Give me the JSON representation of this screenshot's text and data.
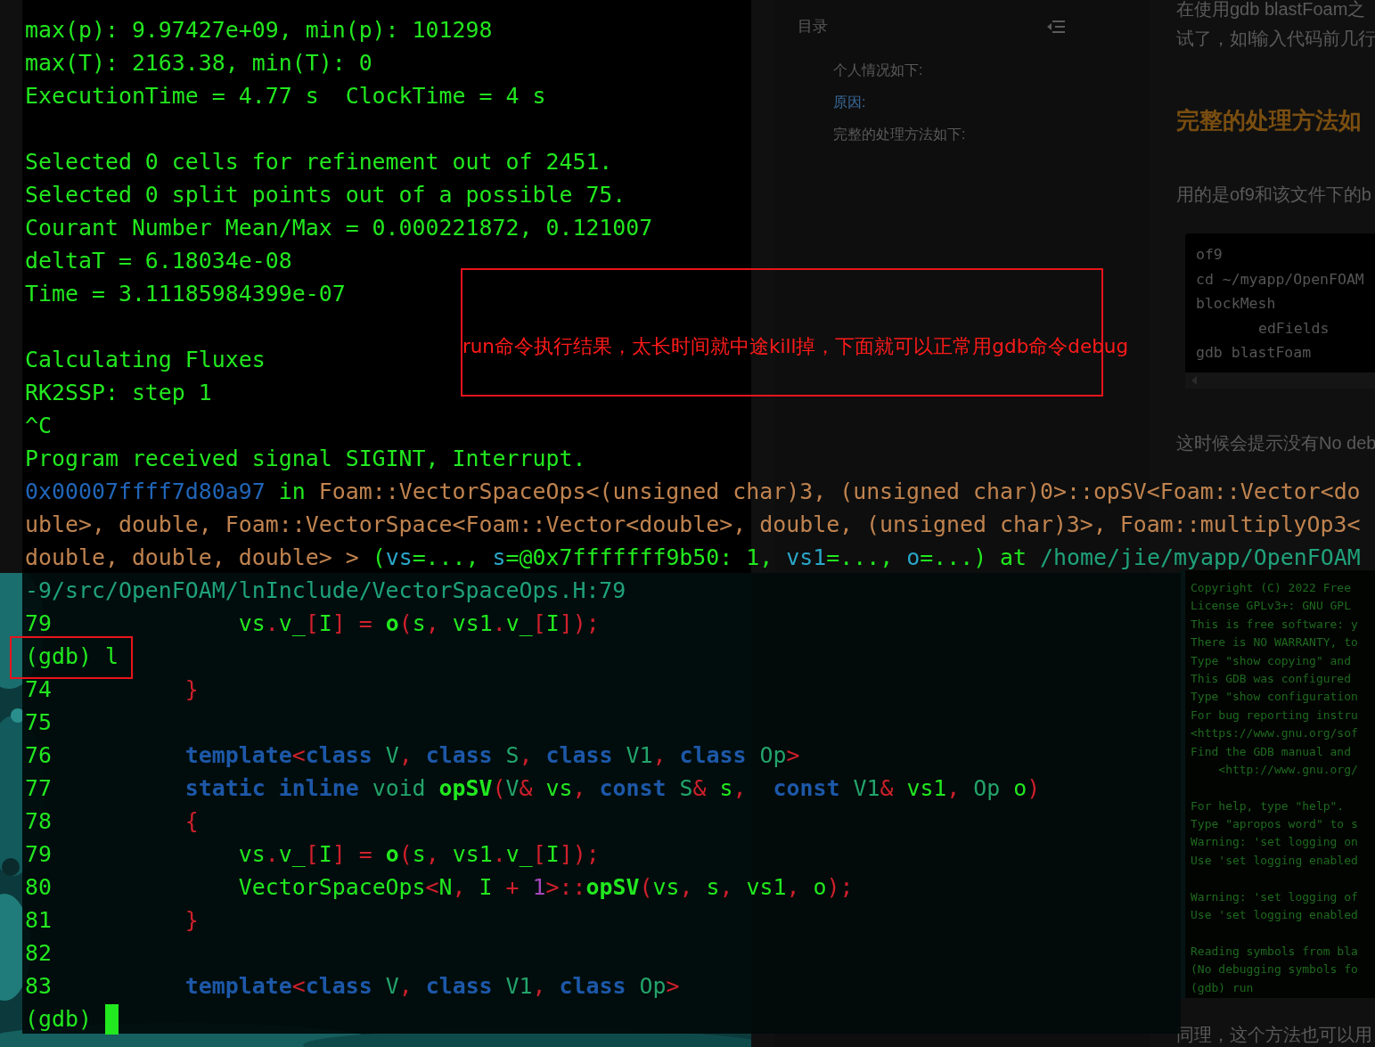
{
  "background_page": {
    "toc": {
      "title": "目录",
      "items": [
        "个人情况如下:",
        "原因:",
        "完整的处理方法如下:"
      ]
    },
    "article": {
      "intro": [
        "在使用gdb blastFoam之",
        "试了，如l输入代码前几行"
      ],
      "heading": "完整的处理方法如",
      "paragraph": "用的是of9和该文件下的b",
      "code_block": [
        {
          "text": "of9"
        },
        {
          "text": "cd ~/myapp/OpenFOAM"
        },
        {
          "text": "blockMesh"
        },
        {
          "text": "edFields"
        },
        {
          "text": "gdb blastFoam"
        }
      ],
      "paragraph_2": "这时候会提示没有No deb",
      "screenshot_lines": [
        {
          "kind": "text",
          "text": "Copyright (C) 2022 Free"
        },
        {
          "kind": "text",
          "text": "License GPLv3+: GNU GPL"
        },
        {
          "kind": "text",
          "text": "This is free software: y"
        },
        {
          "kind": "text",
          "text": "There is NO WARRANTY, to"
        },
        {
          "kind": "text",
          "text": "Type \"show copying\" and"
        },
        {
          "kind": "text",
          "text": "This GDB was configured"
        },
        {
          "kind": "text",
          "text": "Type \"show configuration"
        },
        {
          "kind": "text",
          "text": "For bug reporting instru"
        },
        {
          "kind": "text",
          "text": "<https://www.gnu.org/sof"
        },
        {
          "kind": "text",
          "text": "Find the GDB manual and"
        },
        {
          "kind": "text",
          "text": "    <http://www.gnu.org/"
        },
        {
          "kind": "blank"
        },
        {
          "kind": "text",
          "text": "For help, type \"help\"."
        },
        {
          "kind": "text",
          "text": "Type \"apropos word\" to s"
        },
        {
          "kind": "text",
          "text": "Warning: 'set logging on"
        },
        {
          "kind": "text",
          "text": "Use 'set logging enabled"
        },
        {
          "kind": "blank"
        },
        {
          "kind": "text",
          "text": "Warning: 'set logging of"
        },
        {
          "kind": "text",
          "text": "Use 'set logging enabled"
        },
        {
          "kind": "blank"
        },
        {
          "kind": "text",
          "text": "Reading symbols from bla"
        },
        {
          "kind": "text",
          "text": "(No debugging symbols fo"
        },
        {
          "kind": "text",
          "text": "(gdb) run"
        }
      ],
      "bottom_text": "同理，这个方法也可以用"
    }
  },
  "terminal": {
    "lines": [
      {
        "kind": "text",
        "segments": [
          {
            "t": "max(p): 9.97427e+09, min(p): 101298",
            "kind": "plain"
          }
        ]
      },
      {
        "kind": "text",
        "segments": [
          {
            "t": "max(T): 2163.38, min(T): 0",
            "kind": "plain"
          }
        ]
      },
      {
        "kind": "text",
        "segments": [
          {
            "t": "ExecutionTime = 4.77 s  ClockTime = 4 s",
            "kind": "plain"
          }
        ]
      },
      {
        "kind": "blank"
      },
      {
        "kind": "text",
        "segments": [
          {
            "t": "Selected 0 cells for refinement out of 2451.",
            "kind": "plain"
          }
        ]
      },
      {
        "kind": "text",
        "segments": [
          {
            "t": "Selected 0 split points out of a possible 75.",
            "kind": "plain"
          }
        ]
      },
      {
        "kind": "text",
        "segments": [
          {
            "t": "Courant Number Mean/Max = 0.000221872, 0.121007",
            "kind": "plain"
          }
        ]
      },
      {
        "kind": "text",
        "segments": [
          {
            "t": "deltaT = 6.18034e-08",
            "kind": "plain"
          }
        ]
      },
      {
        "kind": "text",
        "segments": [
          {
            "t": "Time = 3.11185984399e-07",
            "kind": "plain"
          }
        ]
      },
      {
        "kind": "blank"
      },
      {
        "kind": "text",
        "segments": [
          {
            "t": "Calculating Fluxes",
            "kind": "plain"
          }
        ]
      },
      {
        "kind": "text",
        "segments": [
          {
            "t": "RK2SSP: step 1",
            "kind": "plain"
          }
        ]
      },
      {
        "kind": "text",
        "segments": [
          {
            "t": "^C",
            "kind": "plain"
          }
        ]
      },
      {
        "kind": "text",
        "segments": [
          {
            "t": "Program received signal SIGINT, Interrupt.",
            "kind": "plain"
          }
        ]
      },
      {
        "kind": "text",
        "segments": [
          {
            "t": "0x00007ffff7d80a97",
            "kind": "addr"
          },
          {
            "t": " in ",
            "kind": "plain"
          },
          {
            "t": "Foam::VectorSpaceOps<(unsigned char)3, (unsigned char)0>::opSV<Foam::Vector<do",
            "kind": "func"
          }
        ]
      },
      {
        "kind": "text",
        "segments": [
          {
            "t": "uble>, double, Foam::VectorSpace<Foam::Vector<double>, double, (unsigned char)3>, Foam::multiplyOp3<",
            "kind": "func"
          }
        ]
      },
      {
        "kind": "text",
        "segments": [
          {
            "t": "double, double, double> > ",
            "kind": "func"
          },
          {
            "t": "(",
            "kind": "plain"
          },
          {
            "t": "vs",
            "kind": "param"
          },
          {
            "t": "=..., ",
            "kind": "plain"
          },
          {
            "t": "s",
            "kind": "param"
          },
          {
            "t": "=@0x7fffffff9b50: 1, ",
            "kind": "plain"
          },
          {
            "t": "vs1",
            "kind": "param"
          },
          {
            "t": "=..., ",
            "kind": "plain"
          },
          {
            "t": "o",
            "kind": "param"
          },
          {
            "t": "=...) at ",
            "kind": "plain"
          },
          {
            "t": "/home/jie/myapp/OpenFOAM",
            "kind": "path"
          }
        ]
      },
      {
        "kind": "text",
        "segments": [
          {
            "t": "-9/src/OpenFOAM/lnInclude/VectorSpaceOps.H:79",
            "kind": "path"
          }
        ]
      },
      {
        "kind": "text",
        "segments": [
          {
            "t": "79",
            "kind": "plain"
          },
          {
            "t": "              vs",
            "kind": "plain"
          },
          {
            "t": ".",
            "kind": "punct"
          },
          {
            "t": "v_",
            "kind": "plain"
          },
          {
            "t": "[",
            "kind": "punct"
          },
          {
            "t": "I",
            "kind": "plain"
          },
          {
            "t": "] = ",
            "kind": "punct"
          },
          {
            "t": "o",
            "kind": "bold"
          },
          {
            "t": "(",
            "kind": "punct"
          },
          {
            "t": "s",
            "kind": "plain"
          },
          {
            "t": ",",
            "kind": "punct"
          },
          {
            "t": " vs1",
            "kind": "plain"
          },
          {
            "t": ".",
            "kind": "punct"
          },
          {
            "t": "v_",
            "kind": "plain"
          },
          {
            "t": "[",
            "kind": "punct"
          },
          {
            "t": "I",
            "kind": "plain"
          },
          {
            "t": "]);",
            "kind": "punct"
          }
        ]
      },
      {
        "kind": "text",
        "segments": [
          {
            "t": "(gdb) l",
            "kind": "plain"
          }
        ]
      },
      {
        "kind": "text",
        "segments": [
          {
            "t": "74",
            "kind": "plain"
          },
          {
            "t": "          }",
            "kind": "punct"
          }
        ]
      },
      {
        "kind": "text",
        "segments": [
          {
            "t": "75",
            "kind": "plain"
          }
        ]
      },
      {
        "kind": "text",
        "segments": [
          {
            "t": "76",
            "kind": "plain"
          },
          {
            "t": "          template",
            "kind": "keyword"
          },
          {
            "t": "<",
            "kind": "punct"
          },
          {
            "t": "class",
            "kind": "keyword"
          },
          {
            "t": " V",
            "kind": "type"
          },
          {
            "t": ", ",
            "kind": "punct"
          },
          {
            "t": "class",
            "kind": "keyword"
          },
          {
            "t": " S",
            "kind": "type"
          },
          {
            "t": ", ",
            "kind": "punct"
          },
          {
            "t": "class",
            "kind": "keyword"
          },
          {
            "t": " V1",
            "kind": "type"
          },
          {
            "t": ", ",
            "kind": "punct"
          },
          {
            "t": "class",
            "kind": "keyword"
          },
          {
            "t": " Op",
            "kind": "type"
          },
          {
            "t": ">",
            "kind": "punct"
          }
        ]
      },
      {
        "kind": "text",
        "segments": [
          {
            "t": "77",
            "kind": "plain"
          },
          {
            "t": "          static inline",
            "kind": "keyword"
          },
          {
            "t": " void ",
            "kind": "type"
          },
          {
            "t": "opSV",
            "kind": "bold"
          },
          {
            "t": "(",
            "kind": "punct"
          },
          {
            "t": "V",
            "kind": "type"
          },
          {
            "t": "&",
            "kind": "punct"
          },
          {
            "t": " vs",
            "kind": "plain"
          },
          {
            "t": ", ",
            "kind": "punct"
          },
          {
            "t": "const",
            "kind": "keyword"
          },
          {
            "t": " S",
            "kind": "type"
          },
          {
            "t": "&",
            "kind": "punct"
          },
          {
            "t": " s",
            "kind": "plain"
          },
          {
            "t": ",  ",
            "kind": "punct"
          },
          {
            "t": "const",
            "kind": "keyword"
          },
          {
            "t": " V1",
            "kind": "type"
          },
          {
            "t": "&",
            "kind": "punct"
          },
          {
            "t": " vs1",
            "kind": "plain"
          },
          {
            "t": ", ",
            "kind": "punct"
          },
          {
            "t": "Op",
            "kind": "type"
          },
          {
            "t": " o",
            "kind": "plain"
          },
          {
            "t": ")",
            "kind": "punct"
          }
        ]
      },
      {
        "kind": "text",
        "segments": [
          {
            "t": "78",
            "kind": "plain"
          },
          {
            "t": "          {",
            "kind": "punct"
          }
        ]
      },
      {
        "kind": "text",
        "segments": [
          {
            "t": "79",
            "kind": "plain"
          },
          {
            "t": "              vs",
            "kind": "plain"
          },
          {
            "t": ".",
            "kind": "punct"
          },
          {
            "t": "v_",
            "kind": "plain"
          },
          {
            "t": "[",
            "kind": "punct"
          },
          {
            "t": "I",
            "kind": "plain"
          },
          {
            "t": "] = ",
            "kind": "punct"
          },
          {
            "t": "o",
            "kind": "bold"
          },
          {
            "t": "(",
            "kind": "punct"
          },
          {
            "t": "s",
            "kind": "plain"
          },
          {
            "t": ",",
            "kind": "punct"
          },
          {
            "t": " vs1",
            "kind": "plain"
          },
          {
            "t": ".",
            "kind": "punct"
          },
          {
            "t": "v_",
            "kind": "plain"
          },
          {
            "t": "[",
            "kind": "punct"
          },
          {
            "t": "I",
            "kind": "plain"
          },
          {
            "t": "]);",
            "kind": "punct"
          }
        ]
      },
      {
        "kind": "text",
        "segments": [
          {
            "t": "80",
            "kind": "plain"
          },
          {
            "t": "              VectorSpaceOps",
            "kind": "plain"
          },
          {
            "t": "<",
            "kind": "punct"
          },
          {
            "t": "N",
            "kind": "plain"
          },
          {
            "t": ",",
            "kind": "punct"
          },
          {
            "t": " I ",
            "kind": "plain"
          },
          {
            "t": "+ ",
            "kind": "punct"
          },
          {
            "t": "1",
            "kind": "number"
          },
          {
            "t": ">::",
            "kind": "punct"
          },
          {
            "t": "opSV",
            "kind": "bold"
          },
          {
            "t": "(",
            "kind": "punct"
          },
          {
            "t": "vs",
            "kind": "plain"
          },
          {
            "t": ",",
            "kind": "punct"
          },
          {
            "t": " s",
            "kind": "plain"
          },
          {
            "t": ",",
            "kind": "punct"
          },
          {
            "t": " vs1",
            "kind": "plain"
          },
          {
            "t": ",",
            "kind": "punct"
          },
          {
            "t": " o",
            "kind": "plain"
          },
          {
            "t": ");",
            "kind": "punct"
          }
        ]
      },
      {
        "kind": "text",
        "segments": [
          {
            "t": "81",
            "kind": "plain"
          },
          {
            "t": "          }",
            "kind": "punct"
          }
        ]
      },
      {
        "kind": "text",
        "segments": [
          {
            "t": "82",
            "kind": "plain"
          }
        ]
      },
      {
        "kind": "text",
        "segments": [
          {
            "t": "83",
            "kind": "plain"
          },
          {
            "t": "          template",
            "kind": "keyword"
          },
          {
            "t": "<",
            "kind": "punct"
          },
          {
            "t": "class",
            "kind": "keyword"
          },
          {
            "t": " V",
            "kind": "type"
          },
          {
            "t": ", ",
            "kind": "punct"
          },
          {
            "t": "class",
            "kind": "keyword"
          },
          {
            "t": " V1",
            "kind": "type"
          },
          {
            "t": ", ",
            "kind": "punct"
          },
          {
            "t": "class",
            "kind": "keyword"
          },
          {
            "t": " Op",
            "kind": "type"
          },
          {
            "t": ">",
            "kind": "punct"
          }
        ]
      },
      {
        "kind": "prompt",
        "cursor": true,
        "segments": [
          {
            "t": "(gdb)",
            "kind": "plain"
          }
        ]
      }
    ]
  },
  "annotations": [
    {
      "kind": "note",
      "text": "run命令执行结果，太长时间就中途kill掉，下面就可以正常用gdb命令debug"
    },
    {
      "kind": "highlight"
    }
  ]
}
